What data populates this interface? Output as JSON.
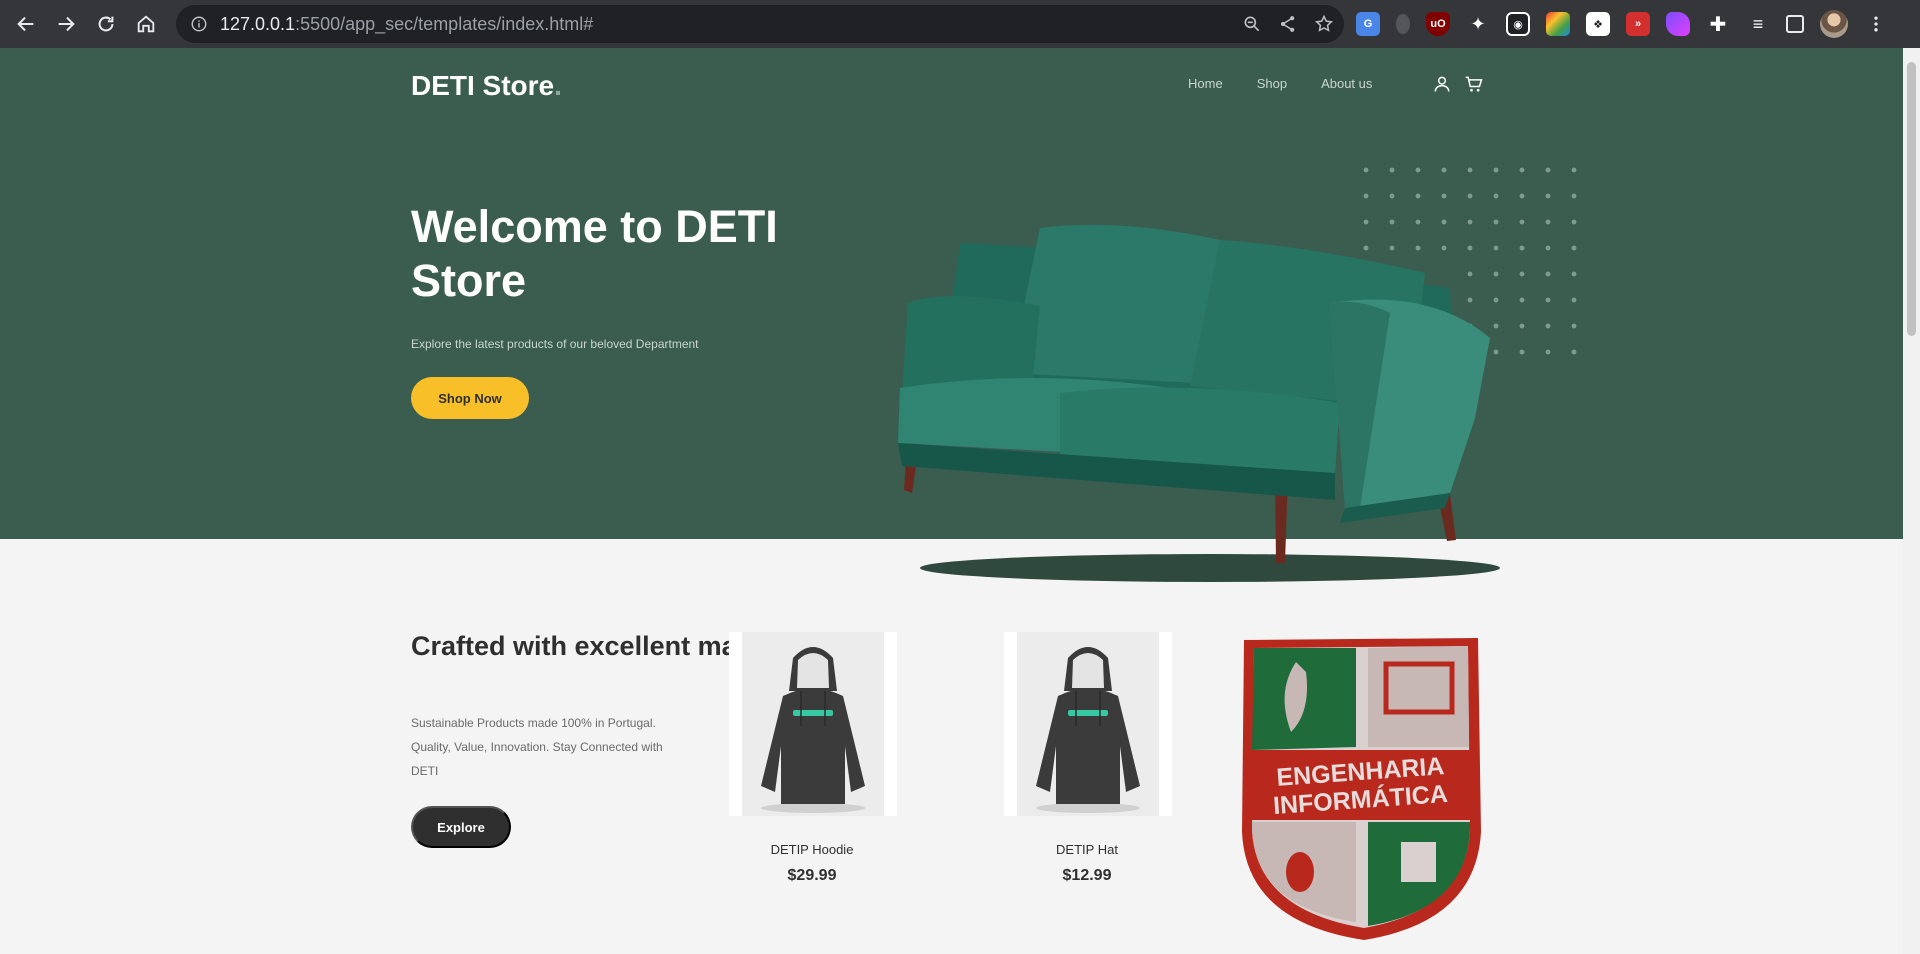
{
  "browser": {
    "url_host": "127.0.0.1",
    "url_path": ":5500/app_sec/templates/index.html#"
  },
  "site": {
    "brand": "DETI Store",
    "brand_dot": ".",
    "nav": [
      "Home",
      "Shop",
      "About us"
    ]
  },
  "hero": {
    "title": "Welcome to DETI Store",
    "subtitle": "Explore the latest products of our beloved Department",
    "cta": "Shop Now"
  },
  "section": {
    "title": "Crafted with excellent material.",
    "text": "Sustainable Products made 100% in Portugal. Quality, Value, Innovation. Stay Connected with DETI",
    "cta": "Explore"
  },
  "products": [
    {
      "name": "DETIP Hoodie",
      "price": "$29.99"
    },
    {
      "name": "DETIP Hat",
      "price": "$12.99"
    }
  ],
  "badge": {
    "line1": "ENGENHARIA",
    "line2": "INFORMÁTICA"
  },
  "colors": {
    "hero_bg": "#3b5d50",
    "accent": "#f9bf29",
    "dark_button": "#2f2f2f"
  },
  "icons": [
    "back-icon",
    "forward-icon",
    "reload-icon",
    "home-icon",
    "info-icon",
    "zoom-icon",
    "share-icon",
    "star-icon",
    "user-icon",
    "cart-icon"
  ]
}
